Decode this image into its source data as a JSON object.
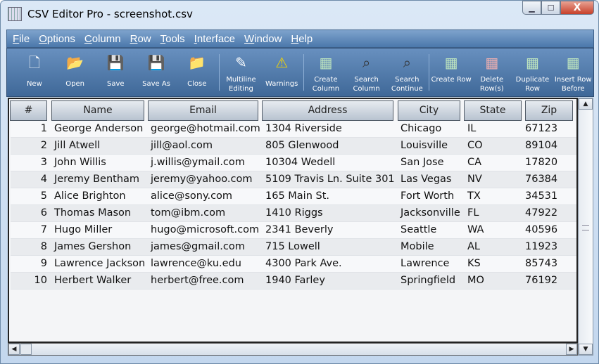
{
  "window": {
    "title": "CSV Editor Pro - screenshot.csv",
    "minimize": "▁",
    "maximize": "☐",
    "close": "X"
  },
  "menu": [
    "File",
    "Options",
    "Column",
    "Row",
    "Tools",
    "Interface",
    "Window",
    "Help"
  ],
  "toolbar": [
    {
      "label": "New",
      "icon": "new-file-icon",
      "glyph": "🗋",
      "color": "#ffffff"
    },
    {
      "label": "Open",
      "icon": "open-folder-icon",
      "glyph": "📂",
      "color": "#f0c860"
    },
    {
      "label": "Save",
      "icon": "save-icon",
      "glyph": "💾",
      "color": "#dd4444"
    },
    {
      "label": "Save As",
      "icon": "save-as-icon",
      "glyph": "💾",
      "color": "#44aa44"
    },
    {
      "label": "Close",
      "icon": "close-folder-icon",
      "glyph": "📁",
      "color": "#f0c860"
    },
    {
      "label": "Multiline Editing",
      "icon": "multiline-edit-icon",
      "glyph": "✎",
      "color": "#ffffff"
    },
    {
      "label": "Warnings",
      "icon": "warning-icon",
      "glyph": "⚠",
      "color": "#f5d400"
    },
    {
      "label": "Create Column",
      "icon": "create-column-icon",
      "glyph": "▦",
      "color": "#bfe6bf"
    },
    {
      "label": "Search Column",
      "icon": "binoculars-icon",
      "glyph": "⌕",
      "color": "#333333"
    },
    {
      "label": "Search Continue",
      "icon": "search-continue-icon",
      "glyph": "⌕",
      "color": "#333333"
    },
    {
      "label": "Create Row",
      "icon": "create-row-icon",
      "glyph": "▦",
      "color": "#bfe6bf"
    },
    {
      "label": "Delete Row(s)",
      "icon": "delete-row-icon",
      "glyph": "▦",
      "color": "#f0b0b0"
    },
    {
      "label": "Duplicate Row",
      "icon": "duplicate-row-icon",
      "glyph": "▦",
      "color": "#bfe6bf"
    },
    {
      "label": "Insert Row Before",
      "icon": "insert-row-icon",
      "glyph": "▦",
      "color": "#bfe6bf"
    }
  ],
  "columns": [
    "#",
    "Name",
    "Email",
    "Address",
    "City",
    "State",
    "Zip"
  ],
  "rows": [
    [
      "1",
      "George Anderson",
      "george@hotmail.com",
      "1304 Riverside",
      "Chicago",
      "IL",
      "67123"
    ],
    [
      "2",
      "Jill Atwell",
      "jill@aol.com",
      "805 Glenwood",
      "Louisville",
      "CO",
      "89104"
    ],
    [
      "3",
      "John Willis",
      "j.willis@ymail.com",
      "10304 Wedell",
      "San Jose",
      "CA",
      "17820"
    ],
    [
      "4",
      "Jeremy Bentham",
      "jeremy@yahoo.com",
      "5109 Travis Ln. Suite 301",
      "Las Vegas",
      "NV",
      "76384"
    ],
    [
      "5",
      "Alice Brighton",
      "alice@sony.com",
      "165 Main St.",
      "Fort Worth",
      "TX",
      "34531"
    ],
    [
      "6",
      "Thomas Mason",
      "tom@ibm.com",
      "1410 Riggs",
      "Jacksonville",
      "FL",
      "47922"
    ],
    [
      "7",
      "Hugo Miller",
      "hugo@microsoft.com",
      "2341 Beverly",
      "Seattle",
      "WA",
      "40596"
    ],
    [
      "8",
      "James Gershon",
      "james@gmail.com",
      "715 Lowell",
      "Mobile",
      "AL",
      "11923"
    ],
    [
      "9",
      "Lawrence Jackson",
      "lawrence@ku.edu",
      "4300 Park Ave.",
      "Lawrence",
      "KS",
      "85743"
    ],
    [
      "10",
      "Herbert Walker",
      "herbert@free.com",
      "1940 Farley",
      "Springfield",
      "MO",
      "76192"
    ]
  ]
}
